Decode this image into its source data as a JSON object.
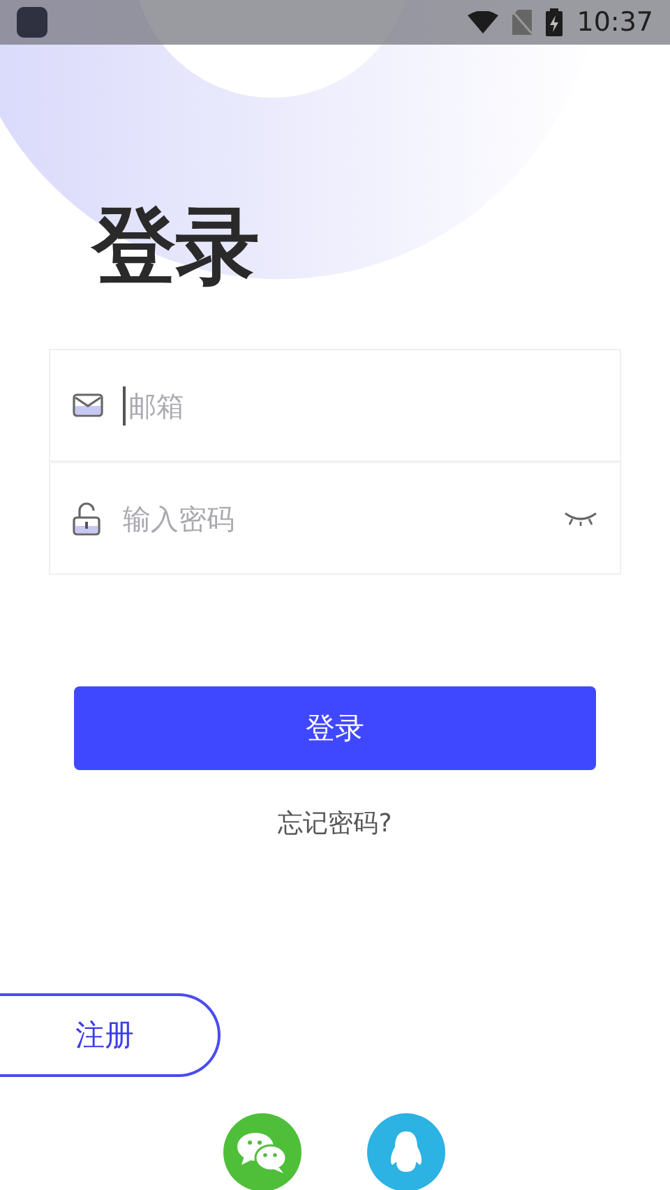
{
  "status_bar": {
    "time": "10:37"
  },
  "title": "登录",
  "fields": [
    {
      "kind": "email",
      "placeholder": "邮箱",
      "focused": true
    },
    {
      "kind": "password",
      "placeholder": "输入密码",
      "focused": false
    }
  ],
  "login_button": "登录",
  "forgot_link": "忘记密码?",
  "register_button": "注册",
  "social": [
    {
      "kind": "chat",
      "color": "#4fbf3a"
    },
    {
      "kind": "penguin",
      "color": "#2cb2e3"
    }
  ]
}
